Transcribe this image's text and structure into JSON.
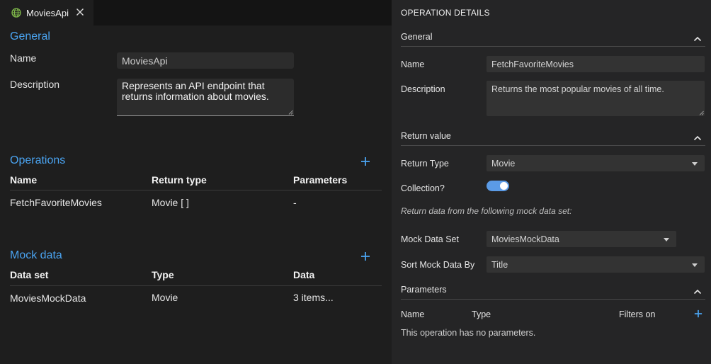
{
  "tab": {
    "label": "MoviesApi",
    "icon": "globe-icon"
  },
  "general": {
    "title": "General",
    "name_label": "Name",
    "name_value": "MoviesApi",
    "description_label": "Description",
    "description_value": "Represents an API endpoint that returns information about movies."
  },
  "operations": {
    "title": "Operations",
    "columns": [
      "Name",
      "Return type",
      "Parameters"
    ],
    "rows": [
      [
        "FetchFavoriteMovies",
        "Movie [ ]",
        "-"
      ]
    ]
  },
  "mock_data": {
    "title": "Mock data",
    "columns": [
      "Data set",
      "Type",
      "Data"
    ],
    "rows": [
      [
        "MoviesMockData",
        "Movie",
        "3 items..."
      ]
    ]
  },
  "details": {
    "title": "OPERATION DETAILS",
    "general": {
      "heading": "General",
      "name_label": "Name",
      "name_value": "FetchFavoriteMovies",
      "description_label": "Description",
      "description_value": "Returns the most popular movies of all time."
    },
    "return_value": {
      "heading": "Return value",
      "type_label": "Return Type",
      "type_value": "Movie",
      "collection_label": "Collection?",
      "collection_on": true,
      "hint": "Return data from the following mock data set:",
      "mock_label": "Mock Data Set",
      "mock_value": "MoviesMockData",
      "sort_label": "Sort Mock Data By",
      "sort_value": "Title"
    },
    "parameters": {
      "heading": "Parameters",
      "columns": [
        "Name",
        "Type",
        "Filters on"
      ],
      "empty": "This operation has no parameters."
    }
  },
  "colors": {
    "accent": "#4aa3f0",
    "toggle": "#5b9be6",
    "globe": "#7fb84a"
  }
}
